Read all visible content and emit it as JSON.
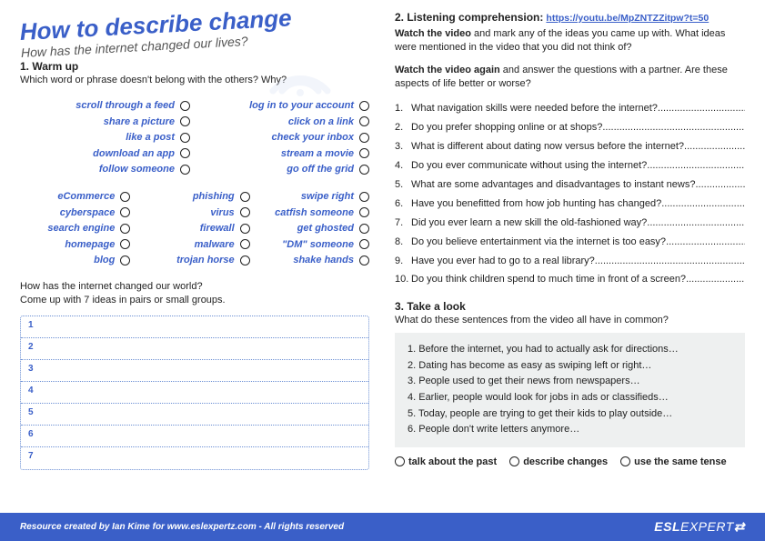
{
  "header": {
    "title": "How to describe change",
    "subtitle": "How has the internet changed our lives?"
  },
  "warmup": {
    "heading": "1. Warm up",
    "prompt": "Which word or phrase doesn't belong with the others? Why?",
    "row1": {
      "colA": [
        "scroll through a feed",
        "share a picture",
        "like a post",
        "download an app",
        "follow someone"
      ],
      "colB": [
        "log in to your account",
        "click on a link",
        "check your inbox",
        "stream a movie",
        "go off the grid"
      ]
    },
    "row2": {
      "colA": [
        "eCommerce",
        "cyberspace",
        "search engine",
        "homepage",
        "blog"
      ],
      "colB": [
        "phishing",
        "virus",
        "firewall",
        "malware",
        "trojan horse"
      ],
      "colC": [
        "swipe right",
        "catfish someone",
        "get ghosted",
        "\"DM\" someone",
        "shake hands"
      ]
    },
    "pair_prompt_1": "How has the internet changed our world?",
    "pair_prompt_2": "Come up with 7 ideas in pairs or small groups.",
    "ideas": [
      "1",
      "2",
      "3",
      "4",
      "5",
      "6",
      "7"
    ]
  },
  "listening": {
    "heading": "2. Listening comprehension:",
    "link": "https://youtu.be/MpZNTZZitpw?t=50",
    "watch1_bold": "Watch the video",
    "watch1_rest": " and mark any of the ideas you came up with. What ideas were mentioned in the video that you did not think of?",
    "watch2_bold": "Watch the video again",
    "watch2_rest": " and answer the questions with a partner. Are these aspects of life better or worse?",
    "questions": [
      "What navigation skills were needed before the internet?",
      "Do you prefer shopping online or at shops?",
      "What is different about dating now versus before the internet?",
      "Do you ever communicate without using the internet?",
      "What are some advantages and disadvantages to instant news?",
      "Have you benefitted from how job hunting has changed?",
      "Did you ever learn a new skill the old-fashioned way?",
      "Do you believe entertainment via the internet is too easy?",
      "Have you ever had to go to a real library?",
      "Do you think children spend to much time in front of a screen?"
    ]
  },
  "takealook": {
    "heading": "3. Take a look",
    "prompt": "What do these sentences from the video all have in common?",
    "sentences": [
      "1. Before the internet, you had to actually ask for directions…",
      "2. Dating has become as easy as swiping left or right…",
      "3. People used to get their news from newspapers…",
      "4. Earlier, people would look for jobs in ads or classifieds…",
      "5. Today, people are trying to get their kids to play outside…",
      "6. People don't write letters anymore…"
    ],
    "choices": [
      "talk about the past",
      "describe changes",
      "use the same tense"
    ]
  },
  "footer": {
    "text": "Resource created by Ian Kime for www.eslexpertz.com - All rights reserved",
    "logo_bold": "ESL",
    "logo_light": "EXPERT"
  }
}
